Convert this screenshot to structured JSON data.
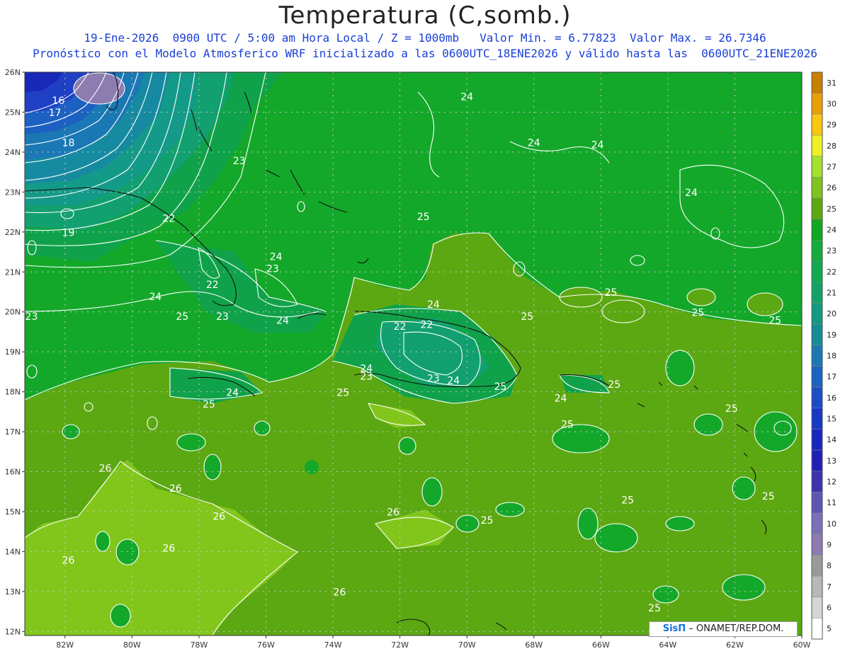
{
  "header": {
    "title": "Temperatura (C,somb.)",
    "subtitle_1": "19-Ene-2026  0900 UTC / 5:00 am Hora Local / Z = 1000mb   Valor Min. = 6.77823  Valor Max. = 26.7346",
    "subtitle_2": "Pronóstico con el Modelo Atmosferico WRF inicializado a las 0600UTC_18ENE2026 y válido hasta las  0600UTC_21ENE2026"
  },
  "credit": {
    "logo": "SisΠ",
    "text": " – ONAMET/REP.DOM."
  },
  "axes": {
    "lat_labels": [
      "12N",
      "13N",
      "14N",
      "15N",
      "16N",
      "17N",
      "18N",
      "19N",
      "20N",
      "21N",
      "22N",
      "23N",
      "24N",
      "25N",
      "26N"
    ],
    "lon_labels": [
      "82W",
      "80W",
      "78W",
      "76W",
      "74W",
      "72W",
      "70W",
      "68W",
      "66W",
      "64W",
      "62W",
      "60W"
    ]
  },
  "colorbar": {
    "labels": [
      "5",
      "6",
      "7",
      "8",
      "9",
      "10",
      "11",
      "12",
      "13",
      "14",
      "15",
      "16",
      "17",
      "18",
      "19",
      "20",
      "21",
      "22",
      "23",
      "24",
      "25",
      "26",
      "27",
      "28",
      "29",
      "30",
      "31"
    ],
    "colors": [
      "#ffffff",
      "#d6d6d6",
      "#b8b8b8",
      "#9a9a9a",
      "#8c7cb0",
      "#7a70b8",
      "#5c56b4",
      "#3a34b0",
      "#2020b8",
      "#1428c0",
      "#1838c8",
      "#1c4cc8",
      "#1c62c0",
      "#1a7ab0",
      "#168c98",
      "#149a80",
      "#12a268",
      "#10a850",
      "#14ac3c",
      "#10a820",
      "#5ca810",
      "#80c41e",
      "#a6e030",
      "#f0f028",
      "#f8c810",
      "#e8a008",
      "#c88000"
    ]
  },
  "contour_labels": [
    {
      "text": "16",
      "lon": -82.2,
      "lat": 25.2
    },
    {
      "text": "17",
      "lon": -82.3,
      "lat": 24.9
    },
    {
      "text": "18",
      "lon": -81.9,
      "lat": 24.15
    },
    {
      "text": "19",
      "lon": -81.9,
      "lat": 21.9
    },
    {
      "text": "22",
      "lon": -78.9,
      "lat": 22.25
    },
    {
      "text": "23",
      "lon": -76.8,
      "lat": 23.7
    },
    {
      "text": "22",
      "lon": -77.6,
      "lat": 20.6
    },
    {
      "text": "23",
      "lon": -75.8,
      "lat": 21.0
    },
    {
      "text": "24",
      "lon": -75.7,
      "lat": 21.3
    },
    {
      "text": "24",
      "lon": -79.3,
      "lat": 20.3
    },
    {
      "text": "25",
      "lon": -78.5,
      "lat": 19.8
    },
    {
      "text": "23",
      "lon": -77.3,
      "lat": 19.8
    },
    {
      "text": "23",
      "lon": -83.0,
      "lat": 19.8
    },
    {
      "text": "24",
      "lon": -75.5,
      "lat": 19.7
    },
    {
      "text": "24",
      "lon": -73.0,
      "lat": 18.5
    },
    {
      "text": "23",
      "lon": -73.0,
      "lat": 18.3
    },
    {
      "text": "25",
      "lon": -73.7,
      "lat": 17.9
    },
    {
      "text": "24",
      "lon": -77.0,
      "lat": 17.9
    },
    {
      "text": "25",
      "lon": -77.7,
      "lat": 17.6
    },
    {
      "text": "22",
      "lon": -72.0,
      "lat": 19.55
    },
    {
      "text": "22",
      "lon": -71.2,
      "lat": 19.6
    },
    {
      "text": "24",
      "lon": -71.0,
      "lat": 20.1
    },
    {
      "text": "23",
      "lon": -71.0,
      "lat": 18.25
    },
    {
      "text": "24",
      "lon": -70.4,
      "lat": 18.2
    },
    {
      "text": "25",
      "lon": -69.0,
      "lat": 18.05
    },
    {
      "text": "24",
      "lon": -67.2,
      "lat": 17.75
    },
    {
      "text": "25",
      "lon": -65.6,
      "lat": 18.1
    },
    {
      "text": "25",
      "lon": -67.0,
      "lat": 17.1
    },
    {
      "text": "25",
      "lon": -71.3,
      "lat": 22.3
    },
    {
      "text": "24",
      "lon": -70.0,
      "lat": 25.3
    },
    {
      "text": "24",
      "lon": -68.0,
      "lat": 24.15
    },
    {
      "text": "24",
      "lon": -66.1,
      "lat": 24.1
    },
    {
      "text": "24",
      "lon": -63.3,
      "lat": 22.9
    },
    {
      "text": "25",
      "lon": -68.2,
      "lat": 19.8
    },
    {
      "text": "25",
      "lon": -65.7,
      "lat": 20.4
    },
    {
      "text": "25",
      "lon": -63.1,
      "lat": 19.9
    },
    {
      "text": "25",
      "lon": -60.8,
      "lat": 19.7
    },
    {
      "text": "25",
      "lon": -62.1,
      "lat": 17.5
    },
    {
      "text": "26",
      "lon": -80.8,
      "lat": 16.0
    },
    {
      "text": "26",
      "lon": -78.7,
      "lat": 15.5
    },
    {
      "text": "26",
      "lon": -77.4,
      "lat": 14.8
    },
    {
      "text": "26",
      "lon": -78.9,
      "lat": 14.0
    },
    {
      "text": "26",
      "lon": -81.9,
      "lat": 13.7
    },
    {
      "text": "26",
      "lon": -72.2,
      "lat": 14.9
    },
    {
      "text": "26",
      "lon": -73.8,
      "lat": 12.9
    },
    {
      "text": "25",
      "lon": -69.4,
      "lat": 14.7
    },
    {
      "text": "25",
      "lon": -65.2,
      "lat": 15.2
    },
    {
      "text": "25",
      "lon": -61.0,
      "lat": 15.3
    },
    {
      "text": "25",
      "lon": -64.4,
      "lat": 12.5
    }
  ]
}
